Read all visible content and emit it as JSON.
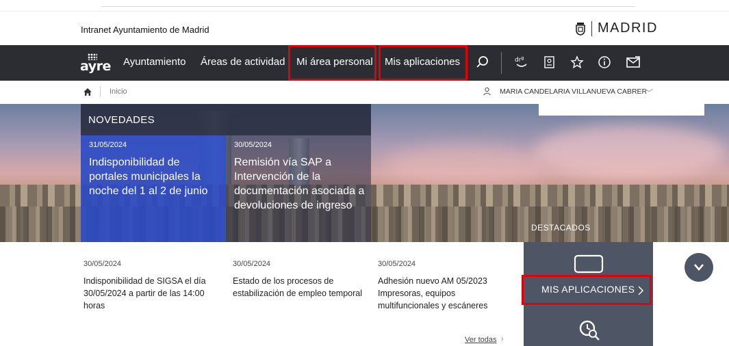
{
  "header": {
    "site_title": "Intranet Ayuntamiento de Madrid",
    "logo_text": "MADRID"
  },
  "navbar": {
    "brand": "ayre",
    "items": [
      {
        "label": "Ayuntamiento"
      },
      {
        "label": "Áreas de actividad"
      },
      {
        "label": "Mi área personal"
      },
      {
        "label": "Mis aplicaciones"
      }
    ],
    "icons": [
      "search-icon",
      "ayre-drop-icon",
      "badge-icon",
      "star-icon",
      "info-icon",
      "mail-icon"
    ]
  },
  "breadcrumb": {
    "home": "Inicio",
    "user": "MARIA CANDELARIA VILLANUEVA CABRER"
  },
  "novedades": {
    "heading": "NOVEDADES",
    "items": [
      {
        "date": "31/05/2024",
        "title": "Indisponibilidad de portales municipales la noche del 1 al 2 de junio"
      },
      {
        "date": "30/05/2024",
        "title": "Remisión vía SAP a Intervención de la documentación asociada a devoluciones de ingreso"
      }
    ]
  },
  "destacados": {
    "label": "DESTACADOS",
    "mis_aplicaciones": "MIS APLICACIONES"
  },
  "news": [
    {
      "date": "30/05/2024",
      "text": "Indisponibilidad de SIGSA el día 30/05/2024 a partir de las 14:00 horas"
    },
    {
      "date": "30/05/2024",
      "text": "Estado de los procesos de estabilización de empleo temporal"
    },
    {
      "date": "30/05/2024",
      "text": "Adhesión nuevo AM 05/2023 Impresoras, equipos multifuncionales y escáneres"
    }
  ],
  "ver_todas": "Ver todas",
  "colors": {
    "navbar_bg": "#2c2c33",
    "highlight_red": "#e3000b",
    "novedades_blue": "#2a4ed7",
    "panel_gray": "#4e5564"
  }
}
